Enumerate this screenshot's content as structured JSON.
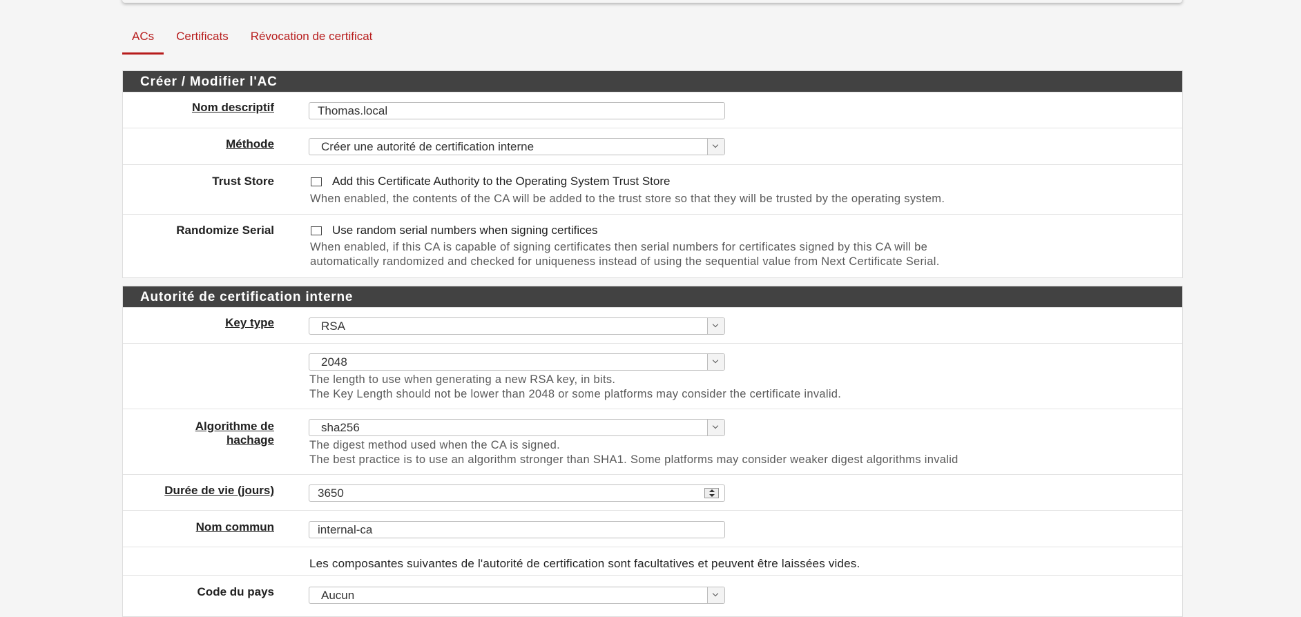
{
  "tabs": [
    {
      "label": "ACs",
      "active": true
    },
    {
      "label": "Certificats",
      "active": false
    },
    {
      "label": "Révocation de certificat",
      "active": false
    }
  ],
  "panel1": {
    "title": "Créer / Modifier l'AC",
    "nom_descriptif": {
      "label": "Nom descriptif",
      "value": "Thomas.local"
    },
    "methode": {
      "label": "Méthode",
      "value": "Créer une autorité de certification interne"
    },
    "trust_store": {
      "label": "Trust Store",
      "checkbox_label": "Add this Certificate Authority to the Operating System Trust Store",
      "help": "When enabled, the contents of the CA will be added to the trust store so that they will be trusted by the operating system."
    },
    "randomize_serial": {
      "label": "Randomize Serial",
      "checkbox_label": "Use random serial numbers when signing certifices",
      "help_line1": "When enabled, if this CA is capable of signing certificates then serial numbers for certificates signed by this CA will be",
      "help_line2": "automatically randomized and checked for uniqueness instead of using the sequential value from Next Certificate Serial."
    }
  },
  "panel2": {
    "title": "Autorité de certification interne",
    "key_type": {
      "label": "Key type",
      "value": "RSA"
    },
    "key_length": {
      "value": "2048",
      "help_line1": "The length to use when generating a new RSA key, in bits.",
      "help_line2": "The Key Length should not be lower than 2048 or some platforms may consider the certificate invalid."
    },
    "hash_algo": {
      "label_line1": "Algorithme de",
      "label_line2": "hachage",
      "value": "sha256",
      "help_line1": "The digest method used when the CA is signed.",
      "help_line2": "The best practice is to use an algorithm stronger than SHA1. Some platforms may consider weaker digest algorithms invalid"
    },
    "lifetime": {
      "label": "Durée de vie (jours)",
      "value": "3650"
    },
    "common_name": {
      "label": "Nom commun",
      "value": "internal-ca"
    },
    "optional_note": "Les composantes suivantes de l'autorité de certification sont facultatives et peuvent être laissées vides.",
    "country_code": {
      "label": "Code du pays",
      "value": "Aucun"
    }
  }
}
